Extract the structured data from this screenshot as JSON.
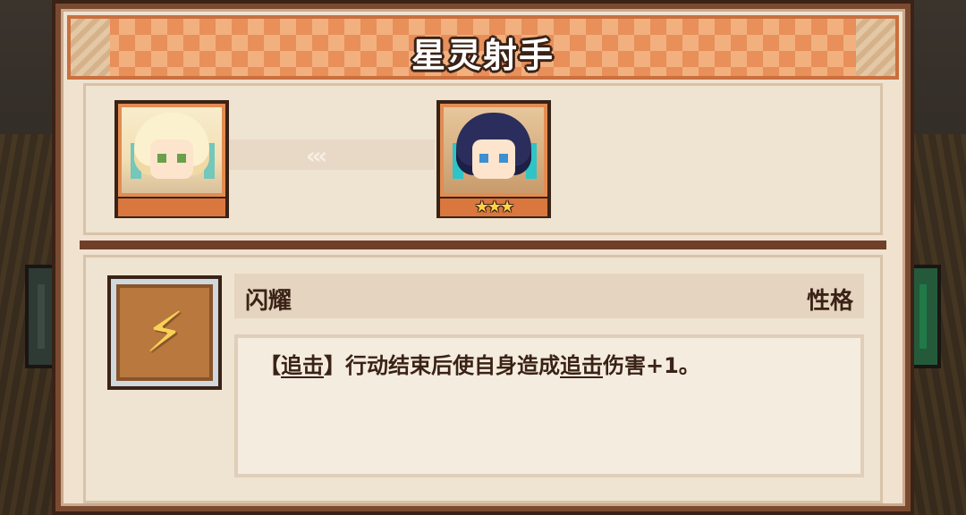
{
  "dialog": {
    "title": "星灵射手"
  },
  "characters": {
    "current": {
      "portrait_icon": "blonde-character-portrait"
    },
    "evolved": {
      "portrait_icon": "dark-hair-character-portrait",
      "stars": "★★★",
      "star_count": 3
    },
    "arrow": "‹‹‹"
  },
  "trait": {
    "icon": "lightning-arrow-icon",
    "icon_glyph": "⚡",
    "name": "闪耀",
    "type": "性格",
    "description": {
      "bracket_open": "【",
      "keyword_1": "追击",
      "bracket_close": "】",
      "text_1": "行动结束后使自身造成",
      "keyword_2": "追击",
      "text_2": "伤害+1。"
    }
  },
  "colors": {
    "frame": "#7a4a30",
    "banner": "#e88f5a",
    "panel": "#efe3d1",
    "text": "#3a2216",
    "star": "#ffd24a"
  }
}
